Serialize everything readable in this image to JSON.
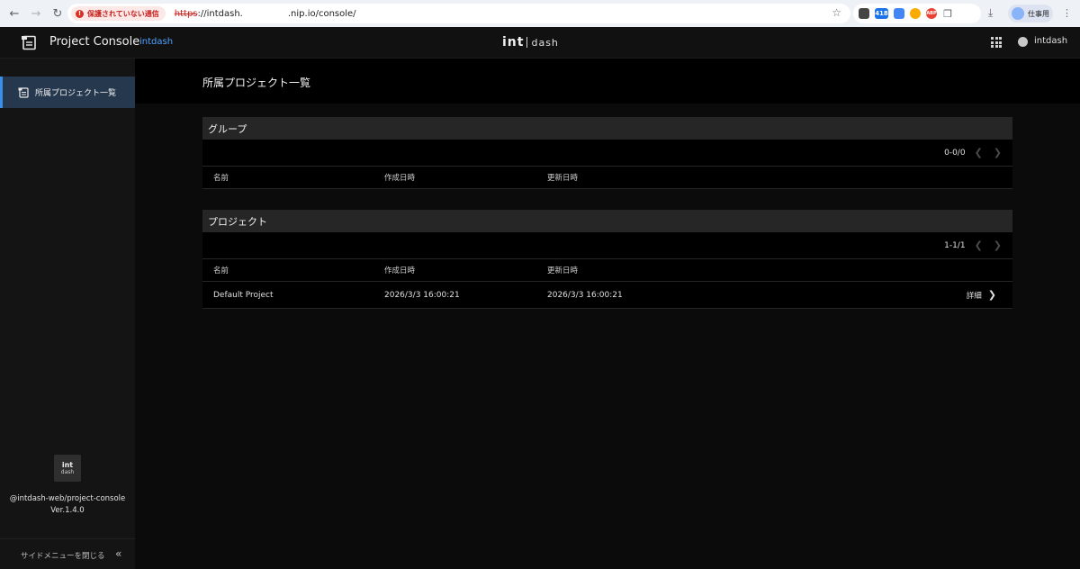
{
  "browser": {
    "security_label": "保護されていない通信",
    "url_scheme": "https",
    "url_host": "://intdash.",
    "url_path": ".nip.io/console/",
    "ext_badge": "418",
    "ext_red": "ABP",
    "profile_label": "仕事用"
  },
  "header": {
    "app_title": "Project Console",
    "tenant": "intdash",
    "brand_int": "int",
    "brand_dash": "dash",
    "user_name": "intdash"
  },
  "sidebar": {
    "items": [
      {
        "label": "所属プロジェクト一覧"
      }
    ],
    "brand_int": "int",
    "brand_dash": "dash",
    "package": "@intdash-web/project-console",
    "version": "Ver.1.4.0",
    "collapse_label": "サイドメニューを閉じる"
  },
  "main": {
    "page_title": "所属プロジェクト一覧",
    "groups": {
      "title": "グループ",
      "pager": "0-0/0",
      "columns": [
        "名前",
        "作成日時",
        "更新日時"
      ],
      "rows": []
    },
    "projects": {
      "title": "プロジェクト",
      "pager": "1-1/1",
      "columns": [
        "名前",
        "作成日時",
        "更新日時"
      ],
      "rows": [
        {
          "name": "Default Project",
          "created": "2026/3/3 16:00:21",
          "updated": "2026/3/3 16:00:21",
          "action": "詳細"
        }
      ]
    }
  },
  "colors": {
    "accent": "#3b8fea",
    "tenant": "#4ea3ff",
    "active_bg": "#26384e"
  },
  "icons": [
    "back-icon",
    "forward-icon",
    "reload-icon",
    "star-icon",
    "download-icon",
    "kebab-icon",
    "apps-grid-icon",
    "user-icon",
    "collapse-icon",
    "chevron-right-icon"
  ]
}
